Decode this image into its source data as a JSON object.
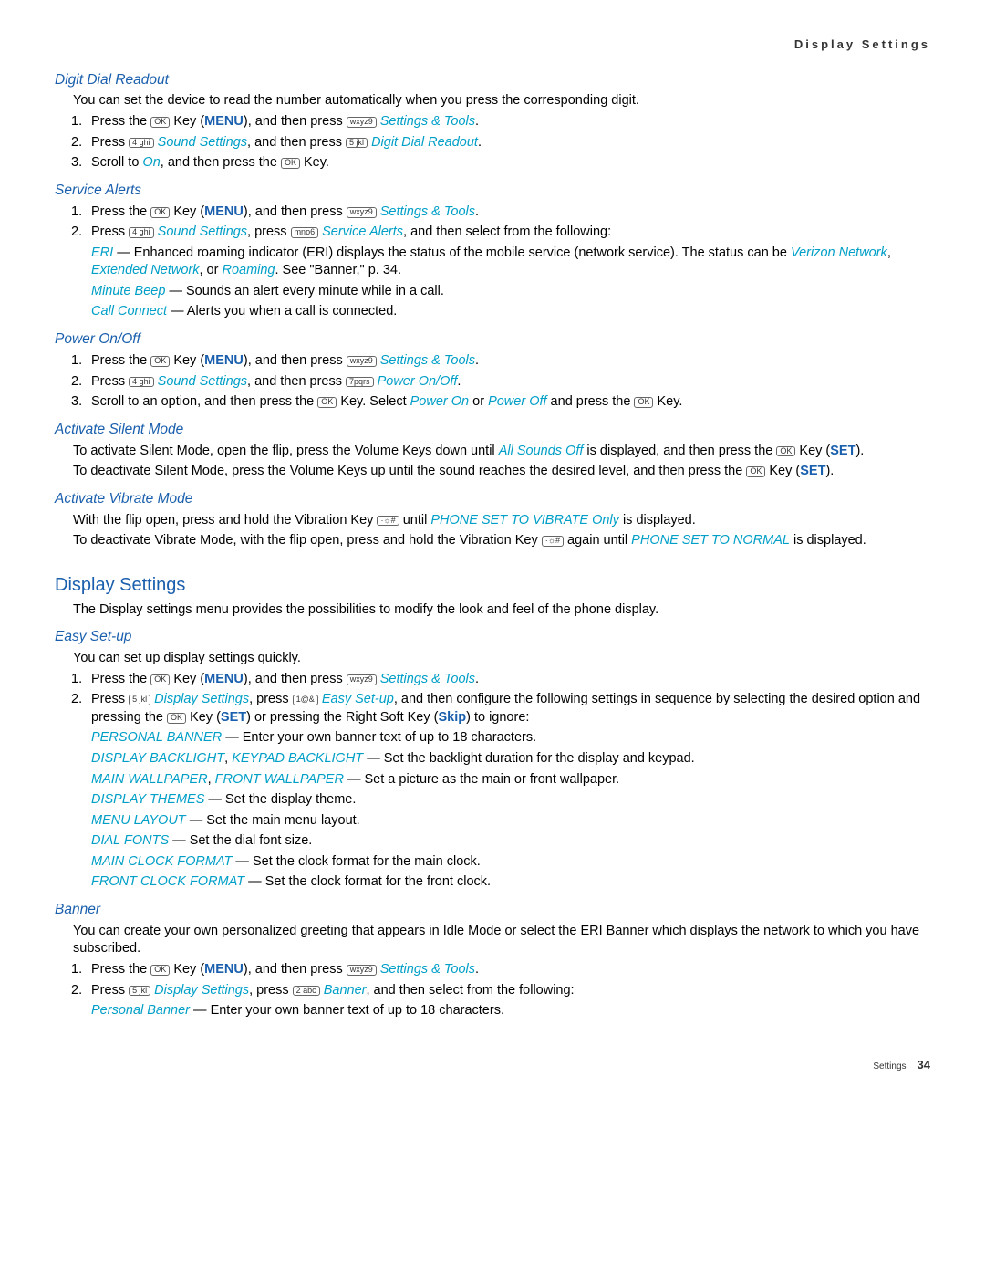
{
  "header": {
    "title": "Display Settings"
  },
  "keys": {
    "ok": "OK",
    "wxyz9": "wxyz9",
    "ghi4": "4 ghi",
    "jkl5": "5 jkl",
    "mno6": "mno6",
    "pqrs7": "7pqrs",
    "abc2": "2 abc",
    "1": "1@&",
    "vib": "·☼#"
  },
  "labels": {
    "menu": "MENU",
    "set": "SET",
    "skip": "Skip"
  },
  "links": {
    "settingsTools": "Settings & Tools",
    "soundSettings": "Sound Settings",
    "digitDialReadout": "Digit Dial Readout",
    "on": "On",
    "serviceAlerts": "Service Alerts",
    "eri": "ERI",
    "verizon": "Verizon Network",
    "extended": "Extended Network",
    "roaming": "Roaming",
    "minuteBeep": "Minute Beep",
    "callConnect": "Call Connect",
    "powerOnOff": "Power On/Off",
    "powerOn": "Power On",
    "powerOff": "Power Off",
    "allSoundsOff": "All Sounds Off",
    "phoneVibrate": "PHONE SET TO VIBRATE Only",
    "phoneNormal": "PHONE SET TO NORMAL",
    "displaySettings": "Display Settings",
    "easySetup": "Easy Set-up",
    "personalBanner": "PERSONAL BANNER",
    "personalBanner2": "Personal Banner",
    "displayBacklight": "DISPLAY BACKLIGHT",
    "keypadBacklight": "KEYPAD BACKLIGHT",
    "mainWallpaper": "MAIN WALLPAPER",
    "frontWallpaper": "FRONT WALLPAPER",
    "displayThemes": "DISPLAY THEMES",
    "menuLayout": "MENU LAYOUT",
    "dialFonts": "DIAL FONTS",
    "mainClockFormat": "MAIN CLOCK FORMAT",
    "frontClockFormat": "FRONT CLOCK FORMAT",
    "banner": "Banner"
  },
  "sections": {
    "digitDial": {
      "title": "Digit Dial Readout",
      "intro": "You can set the device to read the number automatically when you press the corresponding digit.",
      "s1a": "Press the ",
      "s1b": " Key (",
      "s1c": "), and then press ",
      "s2a": "Press ",
      "s2b": ", and then press ",
      "s3a": "Scroll to ",
      "s3b": ", and then press the ",
      "s3c": " Key."
    },
    "serviceAlerts": {
      "title": "Service Alerts",
      "s2a": "Press ",
      "s2b": ", press ",
      "s2c": ", and then select from the following:",
      "eriDesc": " — Enhanced roaming indicator (ERI) displays the status of the mobile service (network service). The status can be ",
      "eriSep1": ", ",
      "eriSep2": ", or ",
      "eriTail": ". See \"Banner,\" p. 34.",
      "minuteDesc": " — Sounds an alert every minute while in a call.",
      "callConnectDesc": " — Alerts you when a call is connected."
    },
    "powerOnOff": {
      "title": "Power On/Off",
      "s3a": "Scroll to an option, and then press the ",
      "s3b": " Key. Select ",
      "s3c": " or ",
      "s3d": " and press the ",
      "s3e": " Key."
    },
    "silent": {
      "title": "Activate Silent Mode",
      "p1a": "To activate Silent Mode, open the flip, press the Volume Keys down until ",
      "p1b": " is displayed, and then press the ",
      "p1c": " Key (",
      "p1d": ").",
      "p2a": "To deactivate Silent Mode, press the Volume Keys up until the sound reaches the desired level, and then press the ",
      "p2b": " Key (",
      "p2c": ")."
    },
    "vibrate": {
      "title": "Activate Vibrate Mode",
      "p1a": "With the flip open, press and hold the Vibration Key ",
      "p1b": " until ",
      "p1c": " is displayed.",
      "p2a": "To deactivate Vibrate Mode, with the flip open, press and hold the Vibration Key ",
      "p2b": " again until ",
      "p2c": " is displayed."
    },
    "display": {
      "title": "Display Settings",
      "intro": "The Display settings menu provides the possibilities to modify the look and feel of the phone display."
    },
    "easy": {
      "title": "Easy Set-up",
      "intro": "You can set up display settings quickly.",
      "s2a": "Press ",
      "s2b": ", press ",
      "s2c": ", and then configure the following settings in sequence by selecting the desired option and pressing the ",
      "s2d": " Key (",
      "s2e": ") or pressing the Right Soft Key (",
      "s2f": ") to ignore:",
      "pbDesc": " — Enter your own banner text of up to 18 characters.",
      "blDesc": " — Set the backlight duration for the display and keypad.",
      "wpDesc": " — Set a picture as the main or front wallpaper.",
      "themeDesc": " — Set the display theme.",
      "menuDesc": " — Set the main menu layout.",
      "dialDesc": " — Set the dial font size.",
      "mcDesc": " — Set the clock format for the main clock.",
      "fcDesc": " — Set the clock format for the front clock.",
      "sep": ", "
    },
    "banner": {
      "title": "Banner",
      "intro": "You can create your own personalized greeting that appears in Idle Mode or select the ERI Banner which displays the network to which you have subscribed.",
      "s2a": "Press ",
      "s2b": ", press ",
      "s2c": ", and then select from the following:",
      "pbDesc": " — Enter your own banner text of up to 18 characters."
    }
  },
  "dot": ".",
  "space": " ",
  "footer": {
    "section": "Settings",
    "page": "34"
  }
}
